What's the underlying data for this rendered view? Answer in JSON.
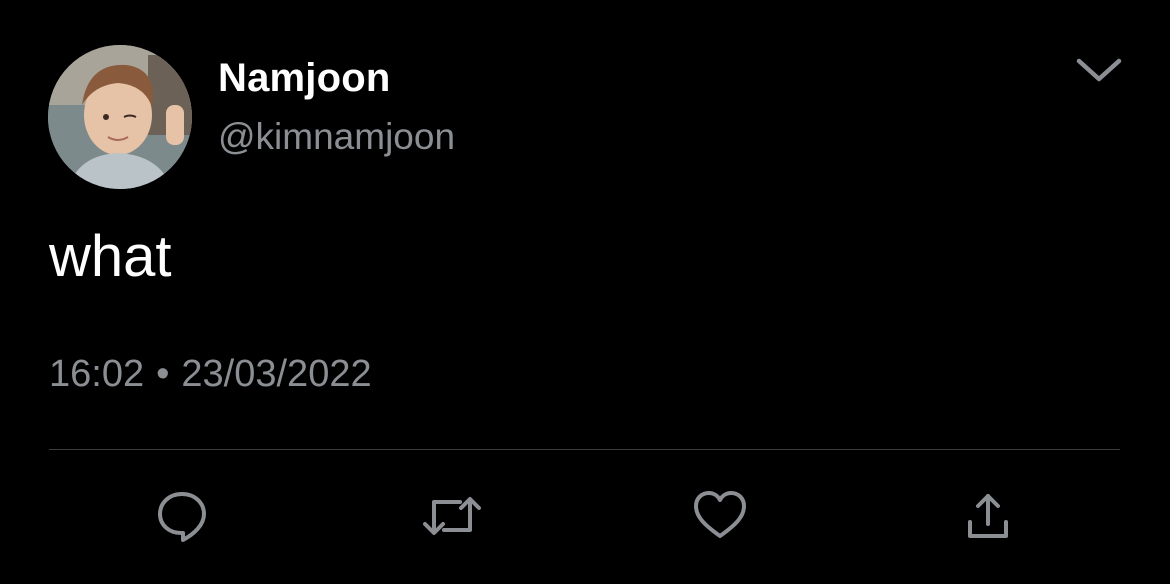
{
  "tweet": {
    "author": {
      "display_name": "Namjoon",
      "handle": "@kimnamjoon",
      "avatar": "profile-photo"
    },
    "text": "what",
    "time": "16:02",
    "separator": "•",
    "date": "23/03/2022",
    "menu_icon": "chevron-down-icon",
    "actions": [
      {
        "name": "reply",
        "icon": "comment-icon"
      },
      {
        "name": "retweet",
        "icon": "retweet-icon"
      },
      {
        "name": "like",
        "icon": "heart-icon"
      },
      {
        "name": "share",
        "icon": "share-icon"
      }
    ]
  },
  "colors": {
    "background": "#000000",
    "primary_text": "#ffffff",
    "secondary_text": "#8b8f93",
    "divider": "#3a3d40",
    "icon": "#8b8f93"
  }
}
